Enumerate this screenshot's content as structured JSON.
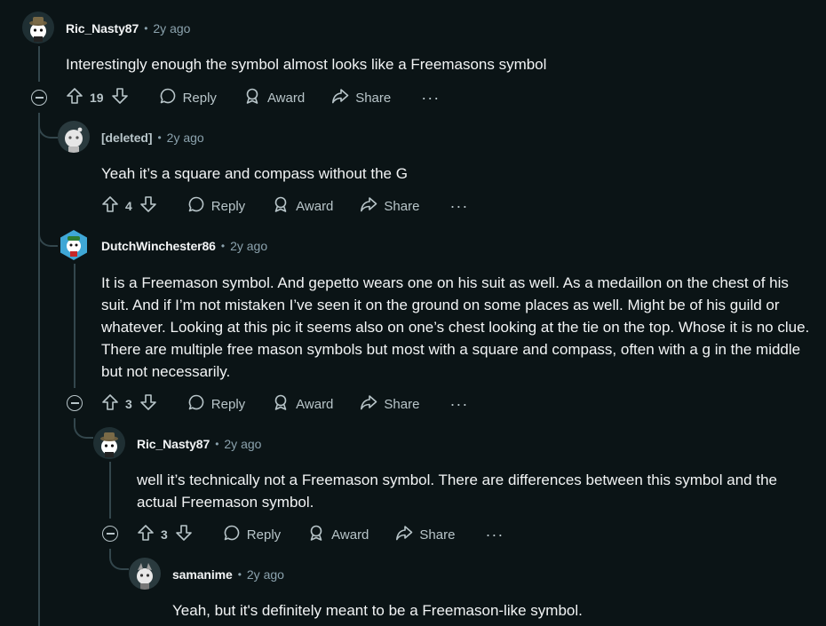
{
  "comments": [
    {
      "author": "Ric_Nasty87",
      "time": "2y ago",
      "body": "Interestingly enough the symbol almost looks like a Freemasons symbol",
      "score": "19",
      "reply_label": "Reply",
      "award_label": "Award",
      "share_label": "Share",
      "more_label": "···"
    },
    {
      "author": "[deleted]",
      "time": "2y ago",
      "body": "Yeah it’s a square and compass without the G",
      "score": "4",
      "reply_label": "Reply",
      "award_label": "Award",
      "share_label": "Share",
      "more_label": "···"
    },
    {
      "author": "DutchWinchester86",
      "time": "2y ago",
      "body": "It is a Freemason symbol. And gepetto wears one on his suit as well. As a medaillon on the chest of his suit. And if I’m not mistaken I’ve seen it on the ground on some places as well. Might be of his guild or whatever. Looking at this pic it seems also on one’s chest looking at the tie on the top. Whose it is no clue. There are multiple free mason symbols but most with a square and compass, often with a g in the middle but not necessarily.",
      "score": "3",
      "reply_label": "Reply",
      "award_label": "Award",
      "share_label": "Share",
      "more_label": "···"
    },
    {
      "author": "Ric_Nasty87",
      "time": "2y ago",
      "body": "well it’s technically not a Freemason symbol. There are differences between this symbol and the actual Freemason symbol.",
      "score": "3",
      "reply_label": "Reply",
      "award_label": "Award",
      "share_label": "Share",
      "more_label": "···"
    },
    {
      "author": "samanime",
      "time": "2y ago",
      "body": "Yeah, but it's definitely meant to be a Freemason-like symbol."
    }
  ],
  "separator": "•",
  "colors": {
    "background": "#0b1416",
    "text": "#f2f4f5",
    "muted": "#8ba2ad",
    "thread": "#33464c"
  }
}
